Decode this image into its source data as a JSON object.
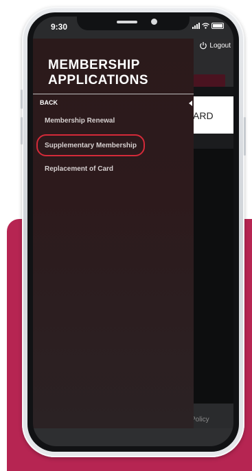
{
  "status_bar": {
    "time": "9:30"
  },
  "header": {
    "logout_label": "Logout",
    "logout_icon": "power-icon"
  },
  "drawer": {
    "title_line1": "MEMBERSHIP",
    "title_line2": "APPLICATIONS",
    "back_label": "BACK",
    "items": [
      {
        "label": "Membership Renewal"
      },
      {
        "label": "Supplementary Membership",
        "highlighted": true
      },
      {
        "label": "Replacement of Card"
      }
    ]
  },
  "background_page": {
    "card_text_fragment": "ARD",
    "footer_text_fragment": "Policy"
  },
  "colors": {
    "accent": "#b62552",
    "highlight_ring": "#d42a39",
    "drawer_bg": "#2b1a1b"
  }
}
